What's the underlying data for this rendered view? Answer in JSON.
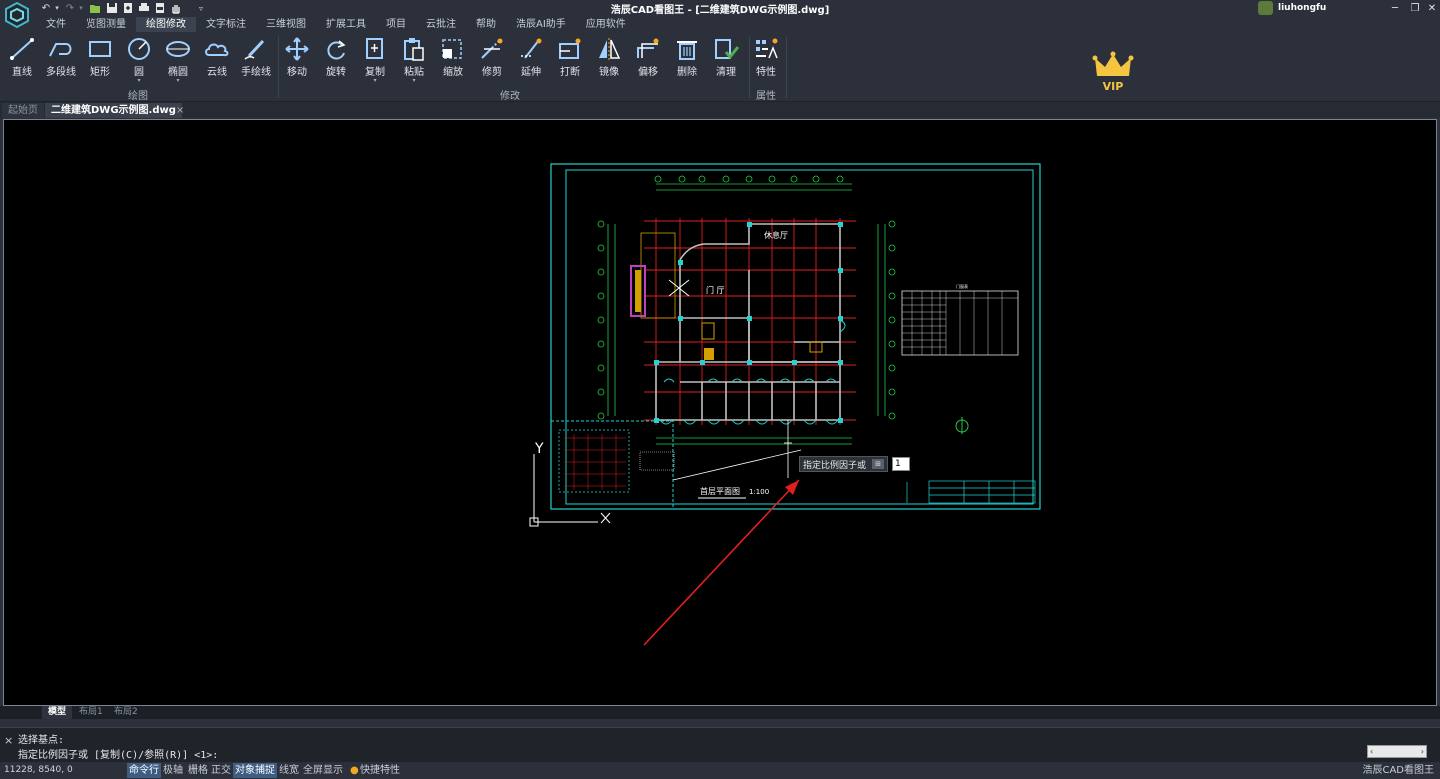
{
  "titlebar": {
    "title": "浩辰CAD看图王 - [二维建筑DWG示例图.dwg]",
    "user": "liuhongfu",
    "qa_icons": [
      "undo-icon",
      "redo-icon",
      "open-folder-icon",
      "save-icon",
      "export-icon",
      "print-icon",
      "hand-icon"
    ]
  },
  "menu": [
    "文件",
    "览图测量",
    "绘图修改",
    "文字标注",
    "三维视图",
    "扩展工具",
    "项目",
    "云批注",
    "帮助",
    "浩辰AI助手",
    "应用软件"
  ],
  "ribbon": {
    "draw_buttons": [
      "直线",
      "多段线",
      "矩形",
      "圆",
      "椭圆",
      "云线",
      "手绘线"
    ],
    "draw_group": "绘图",
    "modify_buttons": [
      "移动",
      "旋转",
      "复制",
      "粘贴",
      "缩放",
      "修剪",
      "延伸",
      "打断",
      "镜像",
      "偏移",
      "删除",
      "清理"
    ],
    "modify_group": "修改",
    "props_button": "特性",
    "props_group": "属性",
    "vip": "VIP"
  },
  "tabs": {
    "start": "起始页",
    "file": "二维建筑DWG示例图.dwg",
    "close": "×"
  },
  "drawing": {
    "room1": "休息厅",
    "room2": "门 厅",
    "plan_title": "首层平面图",
    "scale": "1:100",
    "table_title": "门窗表",
    "axis_y": "Y",
    "axis_x": "X"
  },
  "dynamic_prompt": {
    "text": "指定比例因子或",
    "icon": "⊞",
    "input": "1"
  },
  "layout_tabs": [
    "模型",
    "布局1",
    "布局2"
  ],
  "command": {
    "line1": "选择基点:",
    "line2": "指定比例因子或 [复制(C)/参照(R)] <1>:",
    "close": "×"
  },
  "status": {
    "coords": "11228, 8540, 0",
    "toggles": [
      "命令行",
      "极轴",
      "栅格",
      "正交",
      "对象捕捉",
      "线宽",
      "全屏显示",
      "快捷特性"
    ],
    "active_toggles": [
      "命令行",
      "对象捕捉"
    ],
    "brand": "浩辰CAD看图王"
  },
  "colors": {
    "accent": "#3e5d83",
    "canvas": "#000000",
    "cyan": "#22d3d3",
    "red": "#e02020",
    "green": "#22cc44",
    "vip_gold": "#f5c542"
  }
}
